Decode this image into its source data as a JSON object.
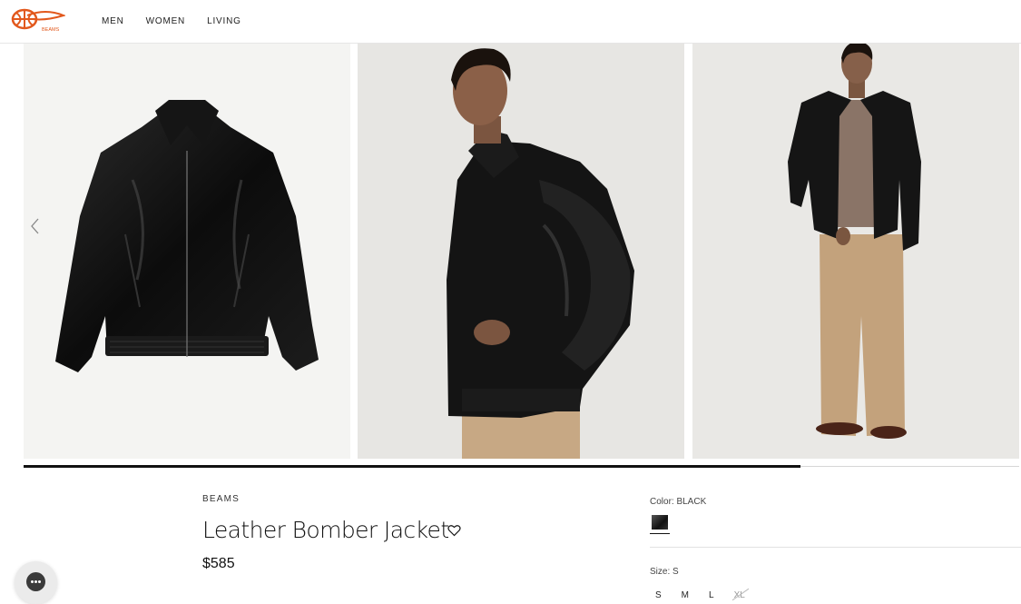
{
  "header": {
    "logo_text": "BEAMS",
    "nav": [
      {
        "label": "MEN"
      },
      {
        "label": "WOMEN"
      },
      {
        "label": "LIVING"
      }
    ]
  },
  "gallery": {
    "images": [
      {
        "icon": "leather-jacket-flat-photo"
      },
      {
        "icon": "model-side-view-photo"
      },
      {
        "icon": "model-full-body-photo"
      }
    ],
    "progress_fraction": 0.78
  },
  "product": {
    "brand": "BEAMS",
    "title": "Leather Bomber Jacket",
    "price": "$585",
    "color_label": "Color: BLACK",
    "size_label": "Size:  S",
    "sizes": [
      "S",
      "M",
      "L",
      "XL"
    ]
  },
  "colors": {
    "accent": "#e2581c",
    "text": "#111111"
  }
}
